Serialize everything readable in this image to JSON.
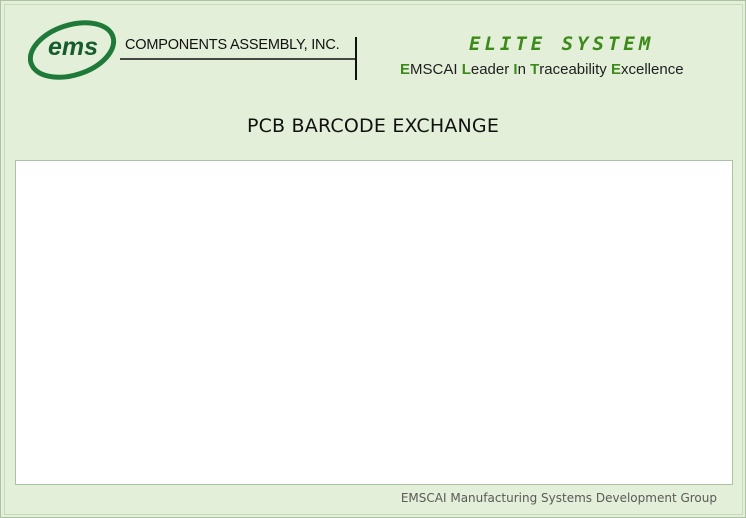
{
  "header": {
    "logo_mark": "ems",
    "logo_company": "COMPONENTS ASSEMBLY, INC.",
    "elite_title": "ELITE SYSTEM",
    "tagline": [
      {
        "cap": "E",
        "rest": "MSCAI "
      },
      {
        "cap": "L",
        "rest": "eader "
      },
      {
        "cap": "I",
        "rest": "n "
      },
      {
        "cap": "T",
        "rest": "raceability "
      },
      {
        "cap": "E",
        "rest": "xcellence"
      }
    ]
  },
  "page": {
    "title": "PCB BARCODE EXCHANGE"
  },
  "footer": {
    "text": "EMSCAI Manufacturing Systems Development Group"
  },
  "colors": {
    "background": "#e3efd9",
    "accent_green": "#3c8a1a",
    "logo_green": "#165c2f",
    "panel_border": "#a9c3a3"
  }
}
